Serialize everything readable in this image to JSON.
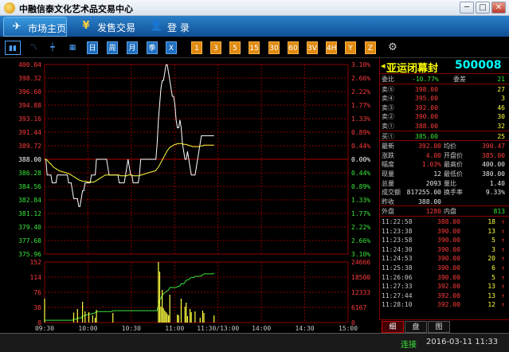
{
  "window": {
    "title": "中融信泰文化艺术品交易中心",
    "min": "─",
    "max": "□",
    "close": "✕"
  },
  "nav": {
    "tabs": [
      {
        "label": "市场主页",
        "icon": "✈"
      },
      {
        "label": "发售交易",
        "icon": "¥"
      },
      {
        "label": "登 录",
        "icon": "👤"
      }
    ]
  },
  "toolbar": {
    "periods": [
      "日",
      "周",
      "月",
      "季",
      "X"
    ],
    "minutes": [
      "1",
      "3",
      "5",
      "15",
      "30",
      "60",
      "3V",
      "4H",
      "Y",
      "Z"
    ]
  },
  "chart_data": {
    "type": "line",
    "prev_close": 388.0,
    "price_ticks": [
      "400.04",
      "398.32",
      "396.60",
      "394.88",
      "393.16",
      "391.44",
      "389.72",
      "388.00",
      "386.28",
      "384.56",
      "382.84",
      "381.12",
      "379.40",
      "377.68",
      "375.96"
    ],
    "pct_ticks": [
      "3.10%",
      "2.66%",
      "2.22%",
      "1.77%",
      "1.33%",
      "0.89%",
      "0.44%",
      "0.00%",
      "0.44%",
      "0.89%",
      "1.33%",
      "1.77%",
      "2.22%",
      "2.66%",
      "3.10%"
    ],
    "vol_ticks_left": [
      "152",
      "114",
      "76",
      "38",
      "0"
    ],
    "vol_ticks_right": [
      "24666",
      "18500",
      "12333",
      "6167",
      "0"
    ],
    "time_labels": [
      "09:30",
      "10:00",
      "10:30",
      "11:00",
      "11:30/13:00",
      "14:00",
      "14:30",
      "15:00"
    ],
    "price": [
      388,
      388,
      386,
      386,
      386,
      386,
      385,
      385,
      385,
      385,
      386,
      386,
      386,
      386,
      386,
      386,
      386,
      386,
      386,
      385,
      385,
      385,
      384,
      383,
      383,
      383,
      383,
      382,
      382,
      383,
      384,
      384,
      385,
      385,
      385,
      385,
      385,
      386,
      386,
      386,
      386,
      388,
      388,
      388,
      388,
      388,
      388,
      388,
      388,
      388,
      387,
      386,
      386,
      386,
      386,
      386,
      386,
      386,
      386,
      385,
      385,
      385,
      385,
      385,
      386,
      387,
      388,
      387,
      386,
      386,
      385,
      385,
      385,
      385,
      385,
      386,
      388,
      388,
      388,
      388,
      388,
      388,
      388,
      388,
      388,
      388,
      388,
      388,
      388,
      390,
      393,
      395,
      397,
      398,
      398,
      399,
      400,
      400,
      399,
      398,
      397,
      396,
      396,
      395,
      393,
      392,
      392,
      393,
      392,
      390,
      389,
      388,
      388,
      389,
      388,
      387,
      386,
      386,
      386,
      386,
      387,
      388,
      389,
      390,
      391,
      391,
      391,
      391,
      391,
      391,
      391,
      391,
      391,
      391,
      391
    ],
    "avg": [
      388,
      388,
      387.9,
      387.7,
      387.5,
      387.4,
      387.2,
      387,
      386.9,
      386.8,
      386.7,
      386.6,
      386.5,
      386.5,
      386.4,
      386.4,
      386.3,
      386.3,
      386.2,
      386.2,
      386.1,
      386,
      385.9,
      385.8,
      385.7,
      385.6,
      385.5,
      385.4,
      385.3,
      385.3,
      385.2,
      385.2,
      385.2,
      385.2,
      385.1,
      385.1,
      385.1,
      385.1,
      385.1,
      385.1,
      385.2,
      385.3,
      385.4,
      385.5,
      385.6,
      385.7,
      385.8,
      385.9,
      386,
      386,
      386,
      386,
      386,
      386,
      386,
      386,
      386,
      386,
      386,
      386,
      385.9,
      385.9,
      385.9,
      385.9,
      385.9,
      385.9,
      386,
      386,
      386,
      386,
      385.9,
      385.9,
      385.9,
      385.9,
      385.9,
      385.9,
      386,
      386,
      386.1,
      386.1,
      386.2,
      386.2,
      386.3,
      386.3,
      386.4,
      386.4,
      386.5,
      386.5,
      386.6,
      386.8,
      387,
      387.3,
      387.6,
      387.9,
      388.2,
      388.5,
      388.8,
      389.1,
      389.3,
      389.5,
      389.6,
      389.7,
      389.8,
      389.9,
      389.9,
      390,
      390,
      390,
      390,
      390,
      389.9,
      389.9,
      389.9,
      389.8,
      389.8,
      389.7,
      389.7,
      389.6,
      389.6,
      389.6,
      389.6,
      389.6,
      389.6,
      389.7,
      389.7,
      389.7,
      389.8,
      389.8,
      389.8,
      389.8,
      389.8,
      389.8,
      389.8,
      389.8,
      389.8
    ],
    "volume": [
      60,
      0,
      0,
      0,
      0,
      0,
      0,
      0,
      0,
      0,
      0,
      0,
      0,
      0,
      0,
      0,
      0,
      0,
      0,
      0,
      0,
      0,
      0,
      25,
      0,
      0,
      34,
      0,
      0,
      0,
      52,
      0,
      28,
      0,
      0,
      26,
      0,
      0,
      18,
      0,
      12,
      32,
      0,
      0,
      0,
      0,
      0,
      0,
      0,
      0,
      0,
      0,
      0,
      0,
      24,
      0,
      0,
      0,
      0,
      0,
      0,
      0,
      0,
      0,
      0,
      0,
      0,
      0,
      0,
      0,
      0,
      0,
      0,
      0,
      0,
      0,
      0,
      0,
      0,
      0,
      0,
      0,
      0,
      0,
      0,
      0,
      0,
      0,
      0,
      0,
      152,
      128,
      40,
      82,
      36,
      30,
      26,
      22,
      18,
      70,
      0,
      0,
      0,
      0,
      0,
      20,
      18,
      0,
      60,
      0,
      0,
      40,
      50,
      16,
      0,
      34,
      26,
      0,
      0,
      28,
      0,
      0,
      0,
      12,
      0,
      30,
      24,
      0,
      0,
      0,
      0,
      0,
      0,
      0,
      18
    ]
  },
  "stock": {
    "name": "亚运闭幕封",
    "code": "500008"
  },
  "quote": {
    "ratio": {
      "label": "委比",
      "value": "-10.77%",
      "diff_label": "委差",
      "diff": "21"
    },
    "asks": [
      {
        "label": "卖⑤",
        "price": "398.00",
        "vol": "27"
      },
      {
        "label": "卖④",
        "price": "395.00",
        "vol": "3"
      },
      {
        "label": "卖③",
        "price": "392.00",
        "vol": "46"
      },
      {
        "label": "卖②",
        "price": "390.00",
        "vol": "30"
      },
      {
        "label": "卖①",
        "price": "388.00",
        "vol": "32"
      }
    ],
    "bids": [
      {
        "label": "买①",
        "price": "385.00",
        "vol": "25"
      }
    ],
    "stats": [
      {
        "l1": "最新",
        "v1": "392.00",
        "l2": "均价",
        "v2": "390.47"
      },
      {
        "l1": "涨跌",
        "v1": "4.00",
        "l2": "开盘价",
        "v2": "385.00"
      },
      {
        "l1": "幅度",
        "v1": "1.03%",
        "l2": "最高价",
        "v2": "400.00"
      },
      {
        "l1": "现量",
        "v1": "12",
        "l2": "最低价",
        "v2": "380.00"
      },
      {
        "l1": "总量",
        "v1": "2093",
        "l2": "量比",
        "v2": "1.40"
      },
      {
        "l1": "成交额",
        "v1": "817255.00",
        "l2": "换手率",
        "v2": "9.33%"
      },
      {
        "l1": "昨收",
        "v1": "388.00",
        "l2": "",
        "v2": ""
      }
    ],
    "outer_label": "外盘",
    "outer": "1280",
    "inner_label": "内盘",
    "inner": "813",
    "ticks": [
      {
        "t": "11:22:58",
        "p": "388.00",
        "v": "18",
        "d": "↑"
      },
      {
        "t": "11:23:38",
        "p": "390.00",
        "v": "13",
        "d": "↑"
      },
      {
        "t": "11:23:58",
        "p": "390.00",
        "v": "5",
        "d": "↑"
      },
      {
        "t": "11:24:30",
        "p": "390.00",
        "v": "3",
        "d": "↑"
      },
      {
        "t": "11:24:53",
        "p": "390.00",
        "v": "20",
        "d": "↑"
      },
      {
        "t": "11:25:38",
        "p": "390.00",
        "v": "6",
        "d": "↑"
      },
      {
        "t": "11:26:06",
        "p": "390.00",
        "v": "5",
        "d": "↑"
      },
      {
        "t": "11:27:33",
        "p": "392.00",
        "v": "13",
        "d": "↑"
      },
      {
        "t": "11:27:44",
        "p": "392.00",
        "v": "13",
        "d": "↑"
      },
      {
        "t": "11:28:10",
        "p": "392.00",
        "v": "12",
        "d": "↑"
      }
    ]
  },
  "bottom_tabs": [
    "细",
    "盘",
    "图"
  ],
  "status": {
    "connection": "连接",
    "datetime": "2016-03-11 11:33"
  },
  "colors": {
    "up": "#ff3b3b",
    "down": "#39e639",
    "grid": "#8b0000",
    "price_line": "#ffffff",
    "avg_line": "#ffff40",
    "volume": "#ffff40"
  }
}
